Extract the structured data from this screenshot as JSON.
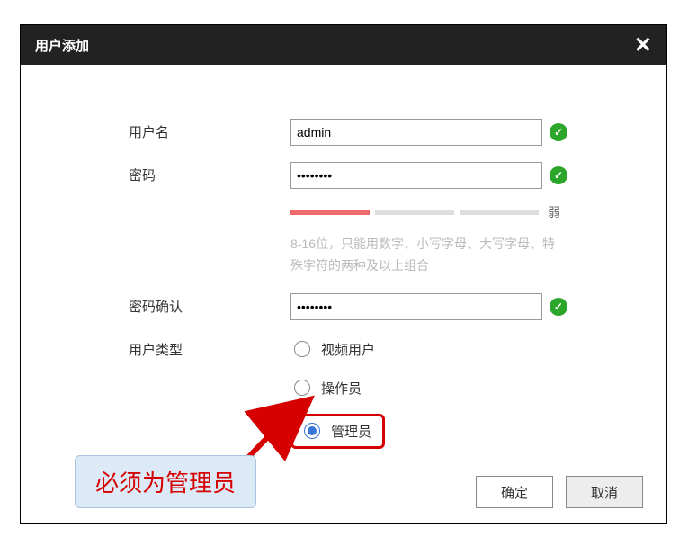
{
  "dialog": {
    "title": "用户添加"
  },
  "form": {
    "username": {
      "label": "用户名",
      "value": "admin"
    },
    "password": {
      "label": "密码",
      "value": "••••••••",
      "strength_label": "弱",
      "hint": "8-16位，只能用数字、小写字母、大写字母、特殊字符的两种及以上组合"
    },
    "password_confirm": {
      "label": "密码确认",
      "value": "••••••••"
    },
    "user_type": {
      "label": "用户类型",
      "options": {
        "video": "视频用户",
        "operator": "操作员",
        "admin": "管理员"
      },
      "selected": "admin"
    }
  },
  "callout": {
    "text": "必须为管理员"
  },
  "buttons": {
    "ok": "确定",
    "cancel": "取消"
  }
}
